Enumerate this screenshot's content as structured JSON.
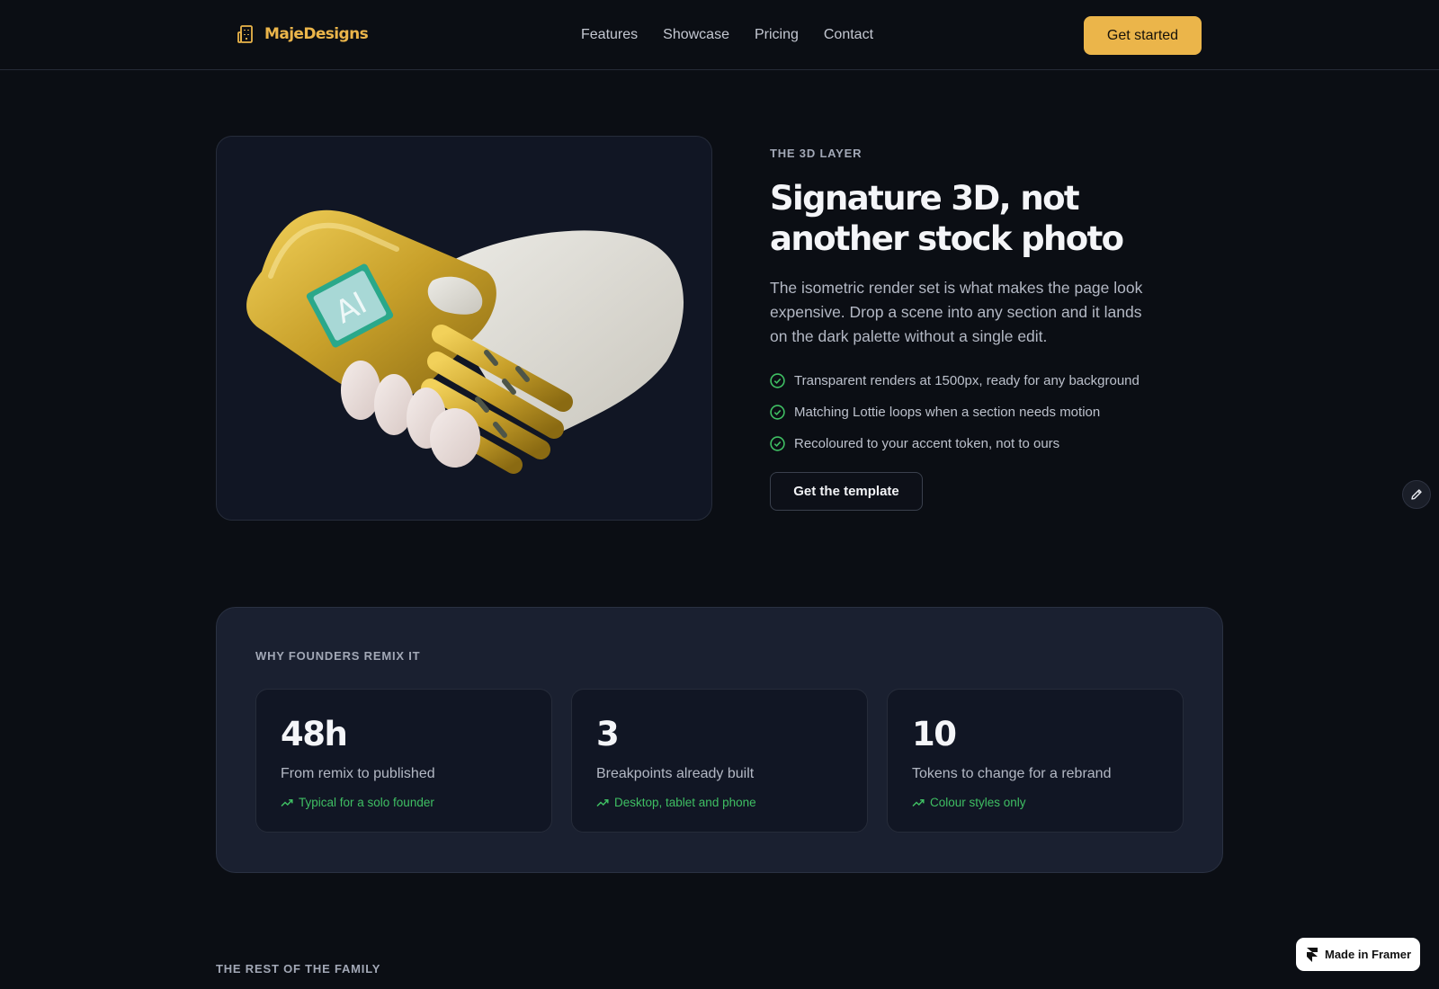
{
  "brand": {
    "name": "MajeDesigns",
    "icon": "building-icon",
    "accent": "#ebb54a"
  },
  "nav": {
    "links": [
      "Features",
      "Showcase",
      "Pricing",
      "Contact"
    ],
    "cta": "Get started"
  },
  "hero": {
    "image_icon": "ai-robot-handshake-illustration",
    "image_text": "AI",
    "eyebrow": "THE 3D LAYER",
    "title_line1": "Signature 3D, not",
    "title_line2": "another stock photo",
    "body": "The isometric render set is what makes the page look expensive. Drop a scene into any section and it lands on the dark palette without a single edit.",
    "checks": [
      "Transparent renders at 1500px, ready for any background",
      "Matching Lottie loops when a section needs motion",
      "Recoloured to your accent token, not to ours"
    ],
    "button": "Get the template"
  },
  "edit_icon": "pencil-icon",
  "stats": {
    "eyebrow": "WHY FOUNDERS REMIX IT",
    "items": [
      {
        "value": "48h",
        "label": "From remix to published",
        "note": "Typical for a solo founder"
      },
      {
        "value": "3",
        "label": "Breakpoints already built",
        "note": "Desktop, tablet and phone"
      },
      {
        "value": "10",
        "label": "Tokens to change for a rebrand",
        "note": "Colour styles only"
      }
    ],
    "note_color": "#3fbf63"
  },
  "family": {
    "eyebrow": "THE REST OF THE FAMILY"
  },
  "framer_badge": {
    "label": "Made in Framer",
    "icon": "framer-icon"
  }
}
